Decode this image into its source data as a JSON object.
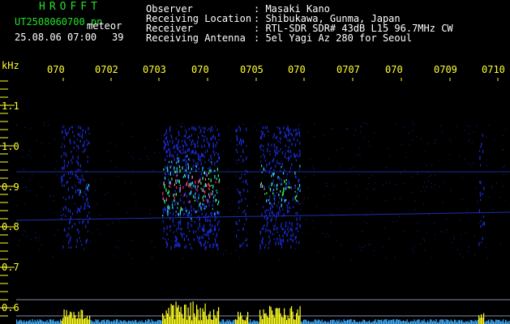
{
  "header": {
    "brand": "HROFFT",
    "filename": "UT2508060700.pn",
    "meteor_label": "meteor",
    "datetime": "25.08.06 07:00",
    "count": "39"
  },
  "info": {
    "rows": [
      {
        "label": "Observer",
        "value": ": Masaki Kano"
      },
      {
        "label": "Receiving Location",
        "value": ": Shibukawa, Gunma, Japan"
      },
      {
        "label": "Receiver",
        "value": ": RTL-SDR SDR# 43dB L15 96.7MHz CW"
      },
      {
        "label": "Receiving Antenna",
        "value": ": 5el Yagi Az 280 for Seoul"
      }
    ]
  },
  "axis": {
    "unit": "kHz",
    "time_ticks": [
      "070",
      "0702",
      "0703",
      "070",
      "0705",
      "070",
      "0707",
      "070",
      "0709",
      "0710"
    ],
    "freq_ticks": [
      "1.1",
      "1.0",
      "0.9",
      "0.8",
      "0.7",
      "0.6"
    ]
  },
  "colors": {
    "green_text": "#22e02a",
    "yellow_text": "#ffff30",
    "signal_blue": "#1a2cd8"
  }
}
